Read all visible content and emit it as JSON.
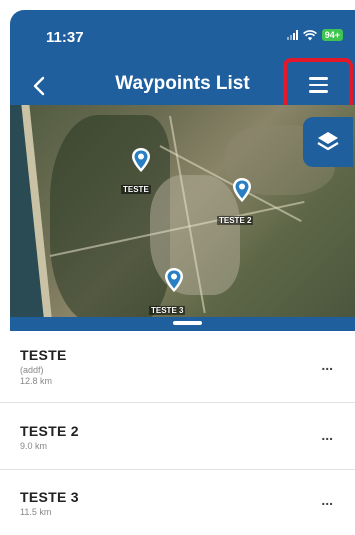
{
  "status_bar": {
    "time": "11:37",
    "battery": "94+"
  },
  "header": {
    "title": "Waypoints List"
  },
  "colors": {
    "primary": "#1f5f9e",
    "highlight": "#e3192a",
    "battery": "#3ec451"
  },
  "icons": {
    "back": "chevron-left-icon",
    "menu": "hamburger-menu-icon",
    "layers": "layers-icon",
    "pin": "map-pin-icon",
    "more": "ellipsis-icon"
  },
  "map": {
    "pins": [
      {
        "label": "TESTE"
      },
      {
        "label": "TESTE 2"
      },
      {
        "label": "TESTE 3"
      }
    ]
  },
  "waypoints": [
    {
      "name": "TESTE",
      "note": "(addf)",
      "distance": "12.8 km",
      "more": "..."
    },
    {
      "name": "TESTE 2",
      "distance": "9.0 km",
      "more": "..."
    },
    {
      "name": "TESTE 3",
      "distance": "11.5 km",
      "more": "..."
    }
  ]
}
